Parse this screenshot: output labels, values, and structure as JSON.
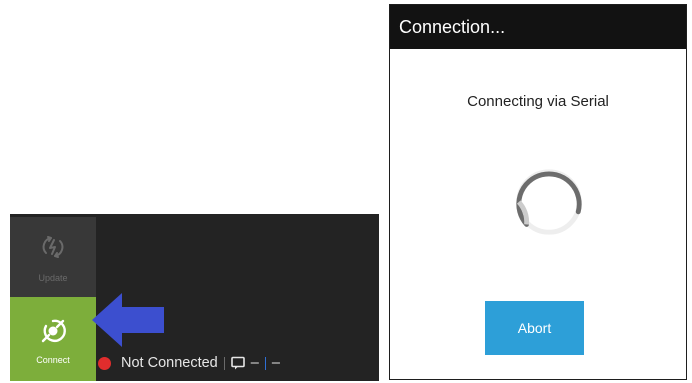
{
  "toolbar": {
    "update_label": "Update",
    "connect_label": "Connect",
    "update_icon": "update-icon",
    "connect_icon": "connect-icon",
    "connect_color": "#7dae3b"
  },
  "status_bar": {
    "status_text": "Not Connected",
    "status_color": "#e02d2d",
    "value_1": "–",
    "value_2": "–"
  },
  "dialog": {
    "title": "Connection...",
    "message": "Connecting via Serial",
    "abort_label": "Abort",
    "abort_color": "#2d9fd8"
  }
}
